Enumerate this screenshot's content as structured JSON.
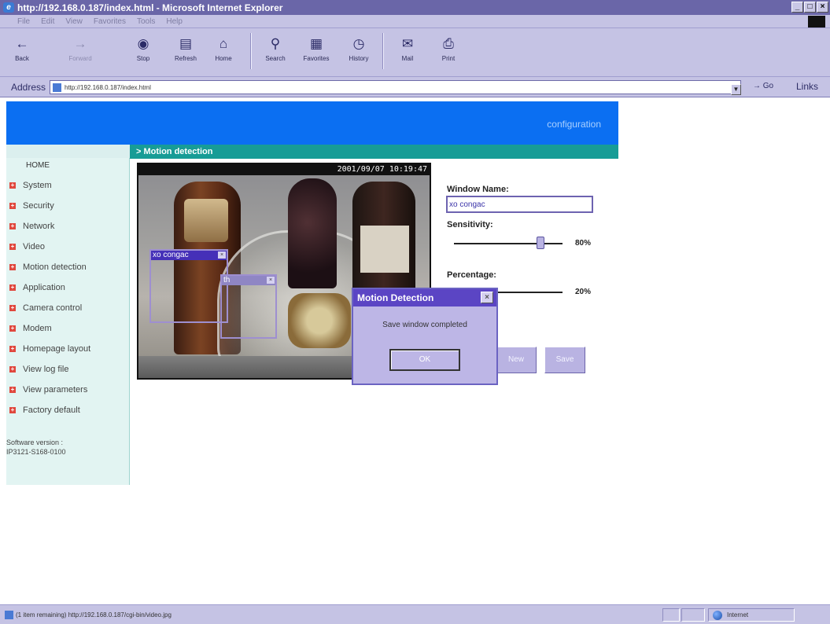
{
  "window": {
    "title": "http://192.168.0.187/index.html - Microsoft Internet Explorer",
    "min_glyph": "_",
    "max_glyph": "□",
    "close_glyph": "×"
  },
  "menu": [
    "File",
    "Edit",
    "View",
    "Favorites",
    "Tools",
    "Help"
  ],
  "toolbar": {
    "back": "Back",
    "forward": "Forward",
    "stop": "Stop",
    "refresh": "Refresh",
    "home": "Home",
    "search": "Search",
    "favorites": "Favorites",
    "history": "History",
    "mail": "Mail",
    "print": "Print"
  },
  "address": {
    "label": "Address",
    "url": "http://192.168.0.187/index.html",
    "go": "Go",
    "links": "Links"
  },
  "header": {
    "configuration": "configuration"
  },
  "section": {
    "title": "> Motion detection"
  },
  "sidebar": {
    "home": "HOME",
    "items": [
      "System",
      "Security",
      "Network",
      "Video",
      "Motion detection",
      "Application",
      "Camera control",
      "Modem",
      "Homepage layout",
      "View log file",
      "View parameters",
      "Factory default"
    ],
    "software_label": "Software version :",
    "software_version": "IP3121-S168-0100"
  },
  "camera": {
    "timestamp": "2001/09/07 10:19:47",
    "window1_name": "xo congac",
    "window2_name": "th"
  },
  "form": {
    "window_name_label": "Window Name:",
    "window_name_value": "xo congac",
    "sensitivity_label": "Sensitivity:",
    "sensitivity_value": "80%",
    "sensitivity_level": 0.8,
    "percentage_label": "Percentage:",
    "percentage_value": "20%",
    "percentage_level": 0.2,
    "new_button": "New",
    "save_button": "Save"
  },
  "dialog": {
    "title": "Motion Detection",
    "message": "Save window completed",
    "ok": "OK"
  },
  "status": {
    "text": "(1 item remaining) http://192.168.0.187/cgi-bin/video.jpg",
    "zone": "Internet"
  },
  "colors": {
    "header_blue": "#0b6ff2",
    "section_teal": "#179c96",
    "chrome_lavender": "#c5c3e4",
    "dialog_title": "#5b45c4"
  }
}
